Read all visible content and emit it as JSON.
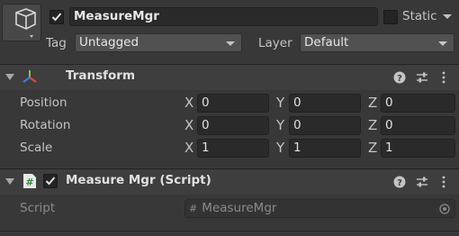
{
  "gameobject": {
    "name": "MeasureMgr",
    "active": true,
    "static_label": "Static",
    "static_checked": false,
    "tag_label": "Tag",
    "tag_value": "Untagged",
    "layer_label": "Layer",
    "layer_value": "Default"
  },
  "transform": {
    "title": "Transform",
    "rows": [
      {
        "label": "Position",
        "x": "0",
        "y": "0",
        "z": "0"
      },
      {
        "label": "Rotation",
        "x": "0",
        "y": "0",
        "z": "0"
      },
      {
        "label": "Scale",
        "x": "1",
        "y": "1",
        "z": "1"
      }
    ],
    "axis_labels": {
      "x": "X",
      "y": "Y",
      "z": "Z"
    }
  },
  "script_component": {
    "title": "Measure Mgr (Script)",
    "enabled": true,
    "field_label": "Script",
    "field_value": "MeasureMgr"
  },
  "colors": {
    "background": "#383838",
    "header": "#3e3e3e",
    "field": "#2a2a2a"
  }
}
